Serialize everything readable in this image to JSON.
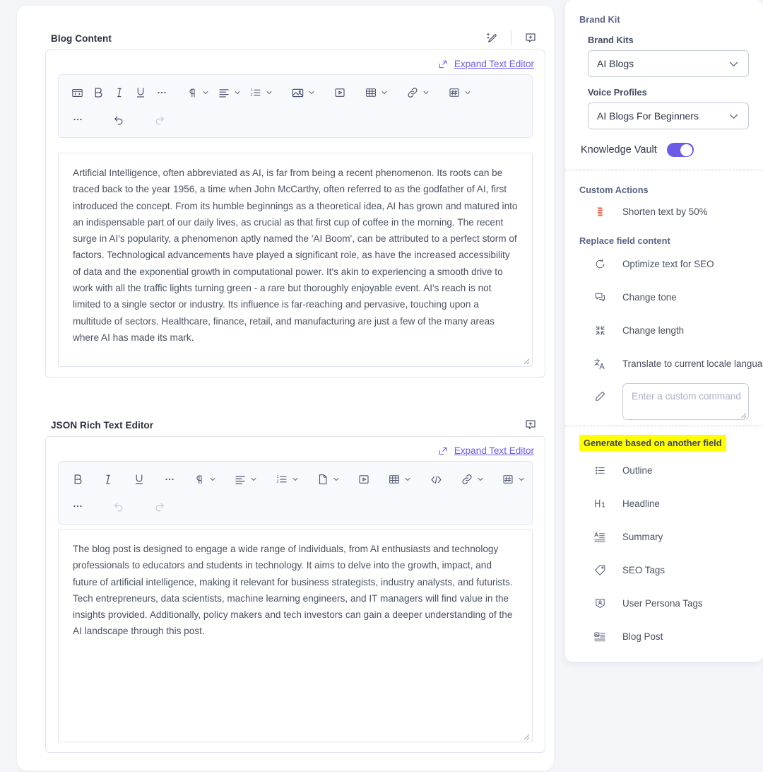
{
  "fields": [
    {
      "title": "Blog Content",
      "expand_label": "Expand Text Editor",
      "body": "Artificial Intelligence, often abbreviated as AI, is far from being a recent phenomenon. Its roots can be traced back to the year 1956, a time when John McCarthy, often referred to as the godfather of AI, first introduced the concept. From its humble beginnings as a theoretical idea, AI has grown and matured into an indispensable part of our daily lives, as crucial as that first cup of coffee in the morning. The recent surge in AI's popularity, a phenomenon aptly named the 'AI Boom', can be attributed to a perfect storm of factors. Technological advancements have played a significant role, as have the increased accessibility of data and the exponential growth in computational power. It's akin to experiencing a smooth drive to work with all the traffic lights turning green - a rare but thoroughly enjoyable event. AI's reach is not limited to a single sector or industry. Its influence is far-reaching and pervasive, touching upon a multitude of sectors. Healthcare, finance, retail, and manufacturing are just a few of the many areas where AI has made its mark."
    },
    {
      "title": "JSON Rich Text Editor",
      "expand_label": "Expand Text Editor",
      "body": "The blog post is designed to engage a wide range of individuals, from AI enthusiasts and technology professionals to educators and students in technology. It aims to delve into the growth, impact, and future of artificial intelligence, making it relevant for business strategists, industry analysts, and futurists. Tech entrepreneurs, data scientists, machine learning engineers, and IT managers will find value in the insights provided. Additionally, policy makers and tech investors can gain a deeper understanding of the AI landscape through this post."
    }
  ],
  "header_tools": {
    "ai_edit": "ai-magic-pencil",
    "comment": "add-comment"
  },
  "toolbar_blog": {
    "row1": [
      {
        "icon": "source-code",
        "caret": false
      },
      {
        "icon": "bold",
        "caret": false
      },
      {
        "icon": "italic",
        "caret": false
      },
      {
        "icon": "underline",
        "caret": false
      },
      {
        "icon": "more-formatting",
        "caret": false
      },
      {
        "icon": "paragraph-style",
        "caret": true
      },
      {
        "icon": "text-align",
        "caret": true
      },
      {
        "icon": "ordered-list",
        "caret": true
      },
      {
        "icon": "image",
        "caret": true
      },
      {
        "icon": "video",
        "caret": false
      },
      {
        "icon": "table",
        "caret": true
      },
      {
        "icon": "link",
        "caret": true
      },
      {
        "icon": "anchor",
        "caret": true
      }
    ],
    "row2": [
      {
        "icon": "more-options",
        "caret": false,
        "disabled": false
      },
      {
        "icon": "undo",
        "caret": false,
        "disabled": false
      },
      {
        "icon": "redo",
        "caret": false,
        "disabled": true
      }
    ]
  },
  "toolbar_json": {
    "row1": [
      {
        "icon": "bold",
        "caret": false
      },
      {
        "icon": "italic",
        "caret": false
      },
      {
        "icon": "underline",
        "caret": false
      },
      {
        "icon": "more-formatting",
        "caret": false
      },
      {
        "icon": "paragraph-style",
        "caret": true
      },
      {
        "icon": "text-align",
        "caret": true
      },
      {
        "icon": "ordered-list",
        "caret": true
      },
      {
        "icon": "page-break",
        "caret": true
      },
      {
        "icon": "video",
        "caret": false
      },
      {
        "icon": "table",
        "caret": true
      },
      {
        "icon": "embed-code",
        "caret": false
      },
      {
        "icon": "link",
        "caret": true
      },
      {
        "icon": "anchor",
        "caret": true
      }
    ],
    "row2": [
      {
        "icon": "more-options",
        "caret": false,
        "disabled": false
      },
      {
        "icon": "undo",
        "caret": false,
        "disabled": true
      },
      {
        "icon": "redo",
        "caret": false,
        "disabled": true
      }
    ]
  },
  "panel": {
    "title": "Brand Kit",
    "brand_kits_label": "Brand Kits",
    "brand_kits_value": "AI Blogs",
    "voice_profiles_label": "Voice Profiles",
    "voice_profiles_value": "AI Blogs For Beginners",
    "knowledge_vault_label": "Knowledge Vault",
    "knowledge_vault_on": true,
    "custom_actions_label": "Custom Actions",
    "custom_actions": [
      {
        "label": "Shorten text by 50%",
        "icon": "compress-arrows-icon"
      }
    ],
    "replace_label": "Replace field content",
    "replace_actions": [
      {
        "label": "Optimize text for SEO",
        "icon": "refresh-icon"
      },
      {
        "label": "Change tone",
        "icon": "chat-bubbles-icon"
      },
      {
        "label": "Change length",
        "icon": "collapse-icon"
      },
      {
        "label": "Translate to current locale language",
        "icon": "translate-icon"
      }
    ],
    "custom_command_placeholder": "Enter a custom command",
    "custom_command_value": "",
    "custom_command_icon": "pencil-icon",
    "generate_label": "Generate based on another field",
    "generate_highlight_color": "#ffff00",
    "generate_actions": [
      {
        "label": "Outline",
        "icon": "list-icon"
      },
      {
        "label": "Headline",
        "icon": "h1-icon"
      },
      {
        "label": "Summary",
        "icon": "summary-icon"
      },
      {
        "label": "SEO Tags",
        "icon": "tag-icon"
      },
      {
        "label": "User Persona Tags",
        "icon": "persona-tag-icon"
      },
      {
        "label": "Blog Post",
        "icon": "blog-post-icon"
      }
    ]
  },
  "colors": {
    "accent": "#6b5ce7",
    "highlight": "#ffff00",
    "custom_action_icon": "#e8604c"
  }
}
